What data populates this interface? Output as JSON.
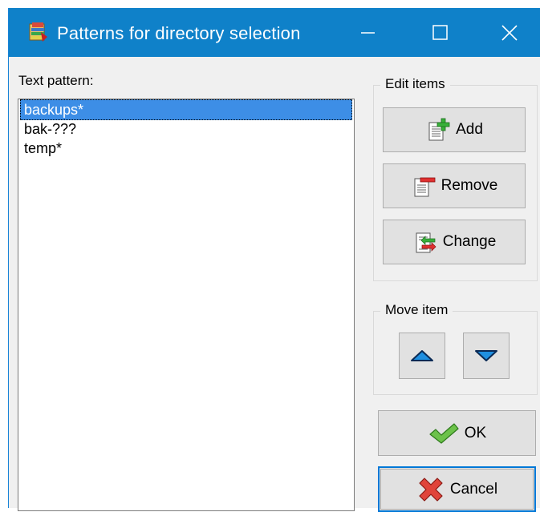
{
  "window": {
    "title": "Patterns for directory selection",
    "controls": [
      "minimize-icon",
      "maximize-icon",
      "close-icon"
    ]
  },
  "pattern_label": "Text pattern:",
  "patterns": [
    {
      "text": "backups*",
      "selected": true
    },
    {
      "text": "bak-???",
      "selected": false
    },
    {
      "text": "temp*",
      "selected": false
    }
  ],
  "edit_group": {
    "title": "Edit items",
    "add_label": "Add",
    "remove_label": "Remove",
    "change_label": "Change"
  },
  "move_group": {
    "title": "Move item",
    "up_icon": "arrow-up-icon",
    "down_icon": "arrow-down-icon"
  },
  "ok_label": "OK",
  "cancel_label": "Cancel",
  "colors": {
    "titlebar": "#0f81c9",
    "selection": "#3d8ee6",
    "dialog_bg": "#f0f0f0",
    "focus_border": "#0078d7"
  }
}
